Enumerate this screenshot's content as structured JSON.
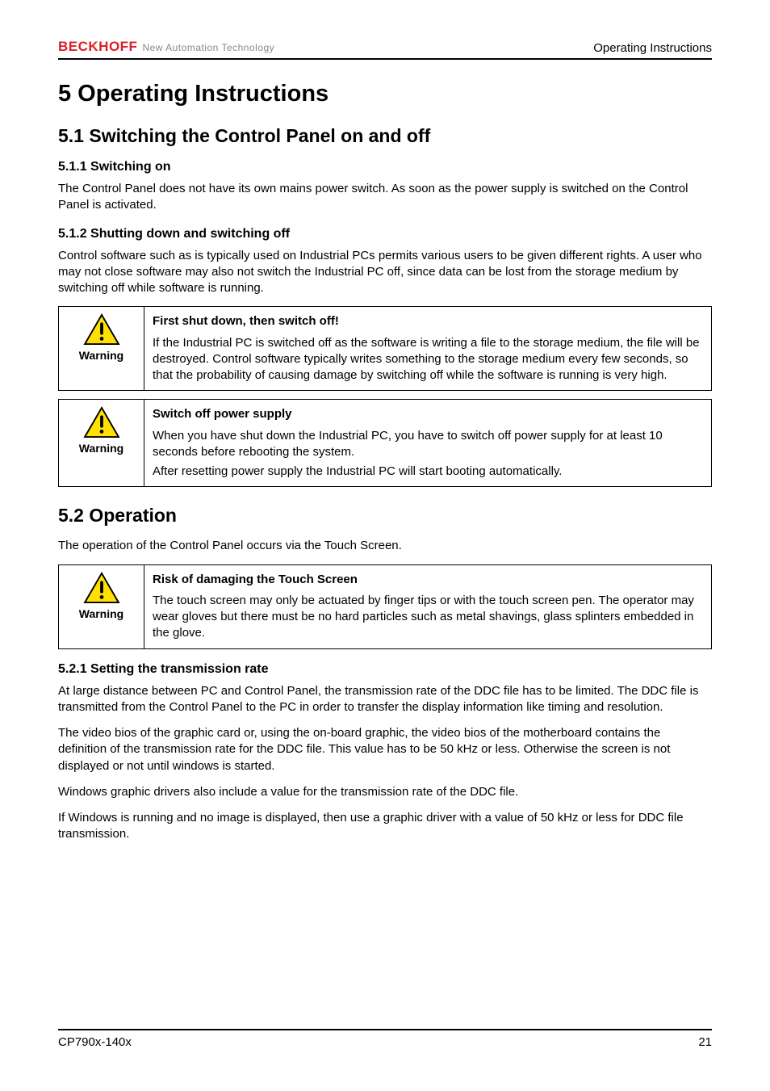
{
  "header": {
    "logo_text": "BECKHOFF",
    "logo_tag": "New Automation Technology",
    "right": "Operating Instructions"
  },
  "h1": "5  Operating Instructions",
  "s51": {
    "title": "5.1  Switching the Control Panel on and off",
    "s511": {
      "title": "5.1.1  Switching on",
      "p": "The Control Panel does not have its own mains power switch. As soon as the power supply is switched on the Control Panel is activated."
    },
    "s512": {
      "title": "5.1.2  Shutting down and switching off",
      "p": "Control software such as is typically used on Industrial PCs permits various users to be given different rights. A user who may not close software may also not switch the Industrial PC off, since data can be lost from the storage medium by switching off while software is running.",
      "warn1": {
        "label": "Warning",
        "title": "First shut down, then switch off!",
        "body": "If the Industrial PC is switched off as the software is writing a file to the storage medium, the file will be destroyed. Control software typically writes something to the storage medium every few seconds, so that the probability of causing damage by switching off while the software is running is very high."
      },
      "warn2": {
        "label": "Warning",
        "title": "Switch off power supply",
        "body": "When you have shut down the Industrial PC, you have to switch off power supply for at least 10 seconds before rebooting the system.",
        "body2": "After resetting power supply the Industrial PC will start booting automatically."
      }
    }
  },
  "s52": {
    "title": "5.2  Operation",
    "p": "The operation of the Control Panel occurs via the Touch Screen.",
    "warn": {
      "label": "Warning",
      "title": "Risk of damaging the Touch Screen",
      "body": "The touch screen may only be actuated by finger tips or with the touch screen pen. The operator may wear gloves but there must be no hard particles such as metal shavings, glass splinters embedded in the glove."
    },
    "s521": {
      "title": "5.2.1  Setting the transmission rate",
      "p1": "At large distance between PC and Control Panel, the transmission rate of the DDC file has to be limited. The DDC file is transmitted from the Control Panel to the PC in order to transfer the display information like timing and resolution.",
      "p2": "The video bios of the graphic card or, using the on-board graphic, the video bios of the motherboard contains the definition of the transmission rate for the DDC file. This value has to be 50 kHz or less. Otherwise the screen is not displayed or not until windows is started.",
      "p3": "Windows graphic drivers also include a value for the transmission rate of the DDC file.",
      "p4": "If Windows is running and no image is displayed, then use a graphic driver with a value of 50 kHz or less for DDC file transmission."
    }
  },
  "footer": {
    "left": "CP790x-140x",
    "right": "21"
  }
}
